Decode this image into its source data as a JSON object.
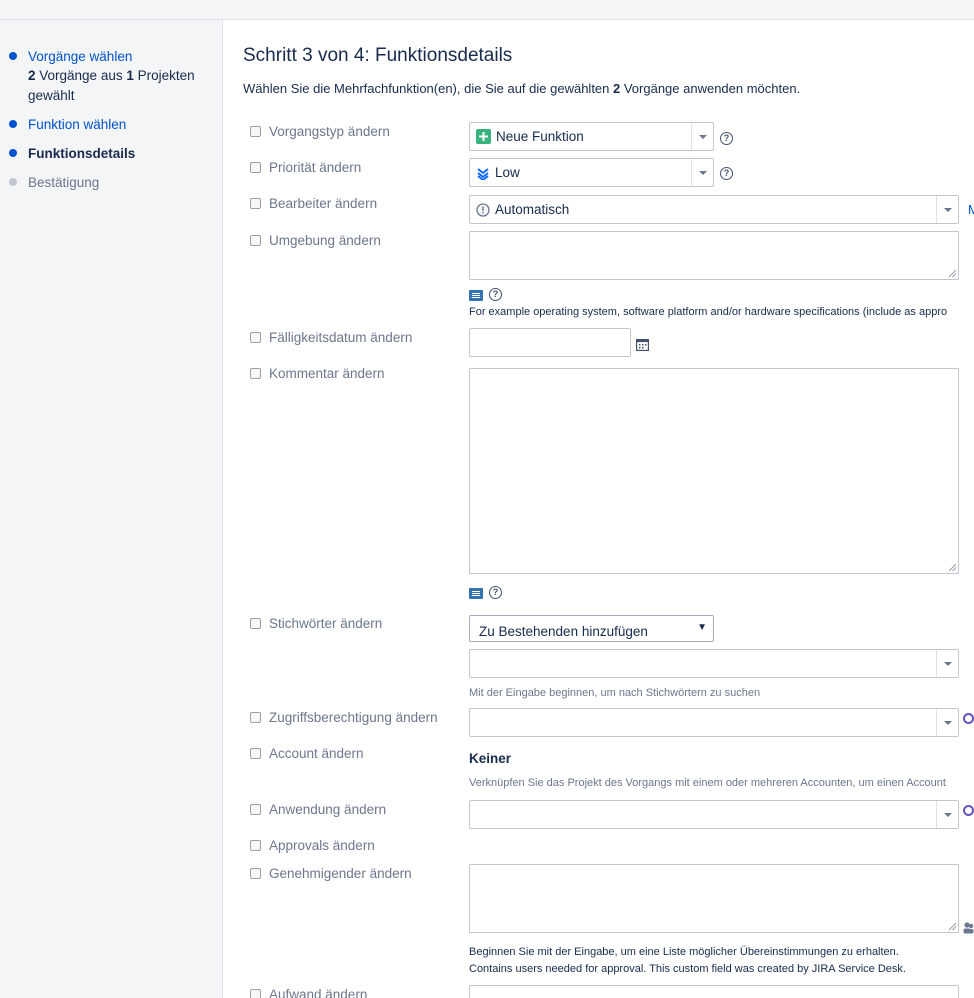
{
  "sidebar": {
    "steps": [
      {
        "label": "Vorgänge wählen",
        "detail_pre": "2",
        "detail_mid": " Vorgänge aus ",
        "detail_num": "1",
        "detail_post": " Projekten gewählt"
      },
      {
        "label": "Funktion wählen"
      },
      {
        "label": "Funktionsdetails"
      },
      {
        "label": "Bestätigung"
      }
    ]
  },
  "main": {
    "title": "Schritt 3 von 4: Funktionsdetails",
    "intro_pre": "Wählen Sie die Mehrfachfunktion(en), die Sie auf die gewählten ",
    "intro_num": "2",
    "intro_post": " Vorgänge anwenden möchten.",
    "fields": {
      "vorgangstyp": {
        "label": "Vorgangstyp ändern",
        "value": "Neue Funktion"
      },
      "prioritaet": {
        "label": "Priorität ändern",
        "value": "Low"
      },
      "bearbeiter": {
        "label": "Bearbeiter ändern",
        "value": "Automatisch",
        "trailing": "M"
      },
      "umgebung": {
        "label": "Umgebung ändern",
        "hint": "For example operating system, software platform and/or hardware specifications (include as appro"
      },
      "faelligkeit": {
        "label": "Fälligkeitsdatum ändern"
      },
      "kommentar": {
        "label": "Kommentar ändern"
      },
      "stichwoerter": {
        "label": "Stichwörter ändern",
        "mode": "Zu Bestehenden hinzufügen",
        "hint": "Mit der Eingabe beginnen, um nach Stichwörtern zu suchen"
      },
      "zugriff": {
        "label": "Zugriffsberechtigung ändern"
      },
      "account": {
        "label": "Account ändern",
        "value": "Keiner",
        "hint": "Verknüpfen Sie das Projekt des Vorgangs mit einem oder mehreren Accounten, um einen Account"
      },
      "anwendung": {
        "label": "Anwendung ändern"
      },
      "approvals": {
        "label": "Approvals ändern"
      },
      "genehmigender": {
        "label": "Genehmigender ändern",
        "hint1": "Beginnen Sie mit der Eingabe, um eine Liste möglicher Übereinstimmungen zu erhalten.",
        "hint2": "Contains users needed for approval. This custom field was created by JIRA Service Desk."
      },
      "aufwand": {
        "label": "Aufwand ändern"
      }
    }
  },
  "colors": {
    "accent": "#0052cc",
    "issue_type_green": "#36b37e",
    "priority_blue": "#0065ff"
  }
}
